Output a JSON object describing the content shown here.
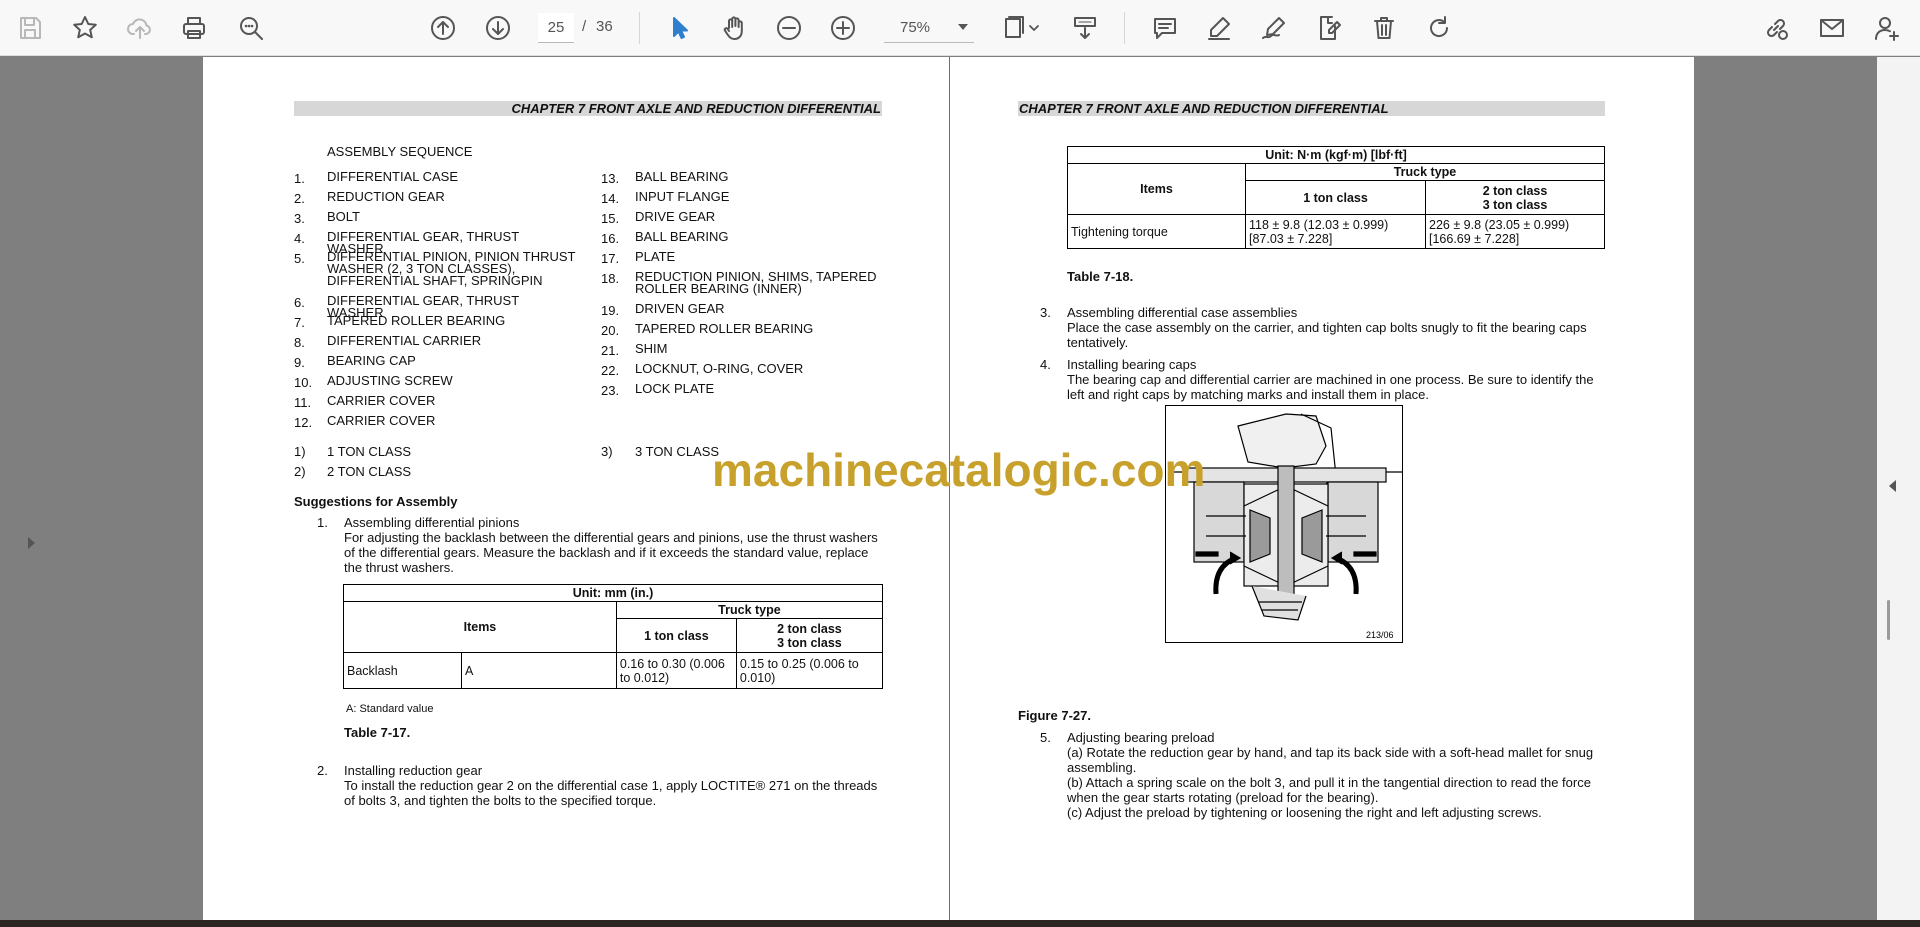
{
  "toolbar": {
    "page_current": "25",
    "page_separator": "/",
    "page_total": "36",
    "zoom": "75%"
  },
  "left_page": {
    "chapter": "CHAPTER 7 FRONT AXLE AND REDUCTION DIFFERENTIAL",
    "sequence_title": "ASSEMBLY SEQUENCE",
    "parts_col1": [
      {
        "num": "1.",
        "text": "DIFFERENTIAL CASE"
      },
      {
        "num": "2.",
        "text": "REDUCTION GEAR"
      },
      {
        "num": "3.",
        "text": "BOLT"
      },
      {
        "num": "4.",
        "text": "DIFFERENTIAL GEAR, THRUST WASHER"
      },
      {
        "num": "5.",
        "text": "DIFFERENTIAL PINION, PINION THRUST WASHER (2, 3 TON CLASSES), DIFFERENTIAL SHAFT, SPRINGPIN"
      },
      {
        "num": "6.",
        "text": "DIFFERENTIAL GEAR, THRUST WASHER"
      },
      {
        "num": "7.",
        "text": "TAPERED ROLLER BEARING"
      },
      {
        "num": "8.",
        "text": "DIFFERENTIAL CARRIER"
      },
      {
        "num": "9.",
        "text": "BEARING CAP"
      },
      {
        "num": "10.",
        "text": "ADJUSTING SCREW"
      },
      {
        "num": "11.",
        "text": "CARRIER COVER"
      },
      {
        "num": "12.",
        "text": "CARRIER COVER"
      }
    ],
    "parts_col2": [
      {
        "num": "13.",
        "text": "BALL BEARING"
      },
      {
        "num": "14.",
        "text": "INPUT FLANGE"
      },
      {
        "num": "15.",
        "text": "DRIVE GEAR"
      },
      {
        "num": "16.",
        "text": "BALL BEARING"
      },
      {
        "num": "17.",
        "text": "PLATE"
      },
      {
        "num": "18.",
        "text": "REDUCTION PINION, SHIMS, TAPERED ROLLER BEARING (INNER)"
      },
      {
        "num": "19.",
        "text": "DRIVEN GEAR"
      },
      {
        "num": "20.",
        "text": "TAPERED ROLLER BEARING"
      },
      {
        "num": "21.",
        "text": "SHIM"
      },
      {
        "num": "22.",
        "text": "LOCKNUT, O-RING, COVER"
      },
      {
        "num": "23.",
        "text": "LOCK PLATE"
      }
    ],
    "notes": [
      {
        "num": "1)",
        "text": "1 TON CLASS"
      },
      {
        "num": "2)",
        "text": "2 TON CLASS"
      },
      {
        "num": "3)",
        "text": "3 TON CLASS"
      }
    ],
    "suggestions_title": "Suggestions for Assembly",
    "step1_num": "1.",
    "step1_title": "Assembling differential pinions",
    "step1_body": "For adjusting the backlash between the differential gears and pinions, use the thrust washers of the differential gears. Measure the backlash and if it exceeds the standard value, replace the thrust washers.",
    "table17": {
      "unit": "Unit: mm (in.)",
      "items": "Items",
      "truck_type": "Truck type",
      "col1": "1 ton class",
      "col2": "2 ton class\n3 ton class",
      "row_label": "Backlash",
      "row_sub": "A",
      "val1": "0.16 to 0.30 (0.006 to 0.012)",
      "val2": "0.15 to 0.25 (0.006 to 0.010)"
    },
    "table17_note": "A: Standard value",
    "table17_caption": "Table 7-17.",
    "step2_num": "2.",
    "step2_title": "Installing reduction gear",
    "step2_body": "To install the reduction gear 2 on the differential case 1, apply LOCTITE® 271 on the threads of bolts 3, and tighten the bolts to the specified torque."
  },
  "right_page": {
    "chapter": "CHAPTER 7 FRONT AXLE AND REDUCTION DIFFERENTIAL",
    "table18": {
      "unit": "Unit: N·m (kgf·m) [lbf·ft]",
      "items": "Items",
      "truck_type": "Truck type",
      "col1": "1 ton class",
      "col2": "2 ton class\n3 ton class",
      "row_label": "Tightening torque",
      "val1": "118 ± 9.8 (12.03 ± 0.999) [87.03 ± 7.228]",
      "val2": "226 ± 9.8 (23.05 ± 0.999) [166.69 ± 7.228]"
    },
    "table18_caption": "Table 7-18.",
    "step3_num": "3.",
    "step3_title": "Assembling differential case assemblies",
    "step3_body": "Place the case assembly on the carrier, and tighten cap bolts snugly to fit the bearing caps tentatively.",
    "step4_num": "4.",
    "step4_title": "Installing bearing caps",
    "step4_body": "The bearing cap and differential carrier are machined in one process. Be sure to identify the left and right caps by matching marks and install them in place.",
    "figure_code": "213/06",
    "figure_caption": "Figure 7-27.",
    "step5_num": "5.",
    "step5_title": "Adjusting bearing preload",
    "step5_a": "(a) Rotate the reduction gear by hand, and tap its back side with a soft-head mallet for snug assembling.",
    "step5_b": "(b) Attach a spring scale on the bolt 3, and pull it in the tangential direction to read the force when the gear starts rotating (preload for the bearing).",
    "step5_c": "(c) Adjust the preload by tightening or loosening the right and left adjusting screws."
  },
  "watermark": "machinecatalogic.com"
}
